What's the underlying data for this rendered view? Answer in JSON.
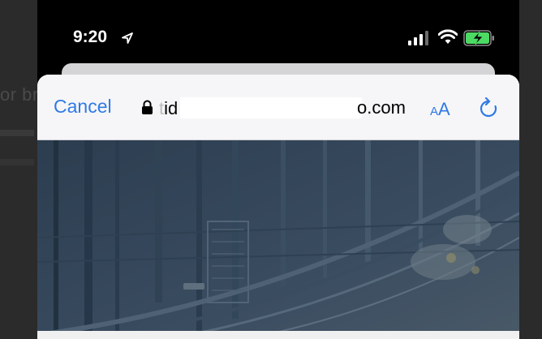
{
  "status_bar": {
    "time": "9:20",
    "icons": [
      "location-arrow-icon",
      "signal-bars-icon",
      "wifi-icon",
      "battery-charging-icon"
    ],
    "battery_color": "#4cd964"
  },
  "background_page": {
    "partial_text": "or br"
  },
  "browser_sheet": {
    "cancel_label": "Cancel",
    "url_prefix_faded": "t",
    "url_prefix": "id",
    "url_suffix": "o.com",
    "text_size_small": "A",
    "text_size_large": "A",
    "accent_color": "#2f7ae5"
  },
  "hero": {
    "description_color": "#34465a"
  }
}
